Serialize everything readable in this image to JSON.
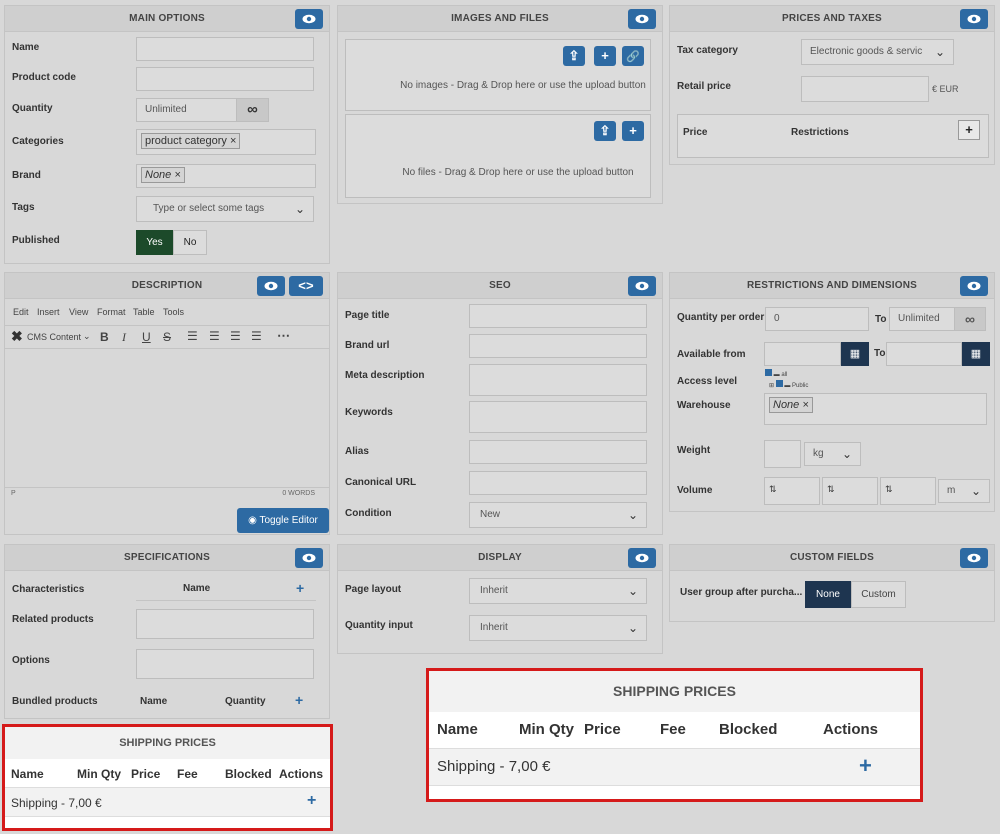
{
  "main_options": {
    "title": "MAIN OPTIONS",
    "name_label": "Name",
    "code_label": "Product code",
    "quantity_label": "Quantity",
    "quantity_value": "Unlimited",
    "categories_label": "Categories",
    "category_tag": "product category ×",
    "brand_label": "Brand",
    "brand_tag": "None ×",
    "tags_label": "Tags",
    "tags_placeholder": "Type or select some tags",
    "published_label": "Published",
    "yes": "Yes",
    "no": "No"
  },
  "images": {
    "title": "IMAGES AND FILES",
    "no_images": "No images - Drag & Drop here or use the upload button",
    "no_files": "No files - Drag & Drop here or use the upload button"
  },
  "prices": {
    "title": "PRICES AND TAXES",
    "tax_label": "Tax category",
    "tax_value": "Electronic goods & servic",
    "retail_label": "Retail price",
    "currency": "€ EUR",
    "price_col": "Price",
    "restrictions_col": "Restrictions"
  },
  "description": {
    "title": "DESCRIPTION",
    "menu": [
      "Edit",
      "Insert",
      "View",
      "Format",
      "Table",
      "Tools"
    ],
    "cms": "CMS Content",
    "status_p": "P",
    "words": "0 WORDS",
    "toggle": "Toggle Editor"
  },
  "seo": {
    "title": "SEO",
    "page_title": "Page title",
    "brand_url": "Brand url",
    "meta": "Meta description",
    "keywords": "Keywords",
    "alias": "Alias",
    "canonical": "Canonical URL",
    "condition": "Condition",
    "condition_value": "New"
  },
  "restrictions": {
    "title": "RESTRICTIONS AND DIMENSIONS",
    "qpo": "Quantity per order",
    "qpo_value": "0",
    "to": "To",
    "unlimited": "Unlimited",
    "available": "Available from",
    "to2": "To",
    "access": "Access level",
    "access_all": "all",
    "access_public": "Public",
    "warehouse": "Warehouse",
    "warehouse_tag": "None ×",
    "weight": "Weight",
    "weight_unit": "kg",
    "volume": "Volume",
    "volume_unit": "m"
  },
  "specs": {
    "title": "SPECIFICATIONS",
    "characteristics": "Characteristics",
    "name_col": "Name",
    "related": "Related products",
    "options": "Options",
    "bundled": "Bundled products",
    "b_name": "Name",
    "b_qty": "Quantity"
  },
  "display": {
    "title": "DISPLAY",
    "layout": "Page layout",
    "layout_value": "Inherit",
    "qinput": "Quantity input",
    "qinput_value": "Inherit"
  },
  "custom": {
    "title": "CUSTOM FIELDS",
    "group_label": "User group after purcha...",
    "none": "None",
    "custom": "Custom"
  },
  "shipping": {
    "title": "SHIPPING PRICES",
    "cols": [
      "Name",
      "Min Qty",
      "Price",
      "Fee",
      "Blocked",
      "Actions"
    ],
    "row": "Shipping - 7,00 €"
  }
}
